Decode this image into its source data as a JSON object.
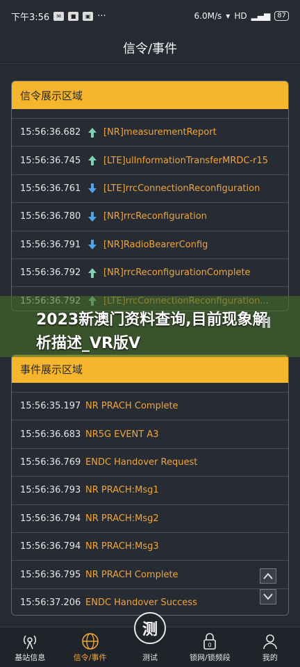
{
  "status_bar": {
    "time": "下午3:56",
    "speed": "6.0M/s",
    "battery": "87"
  },
  "title": "信令/事件",
  "signaling_panel": {
    "header": "信令展示区域",
    "rows": [
      {
        "time": "15:56:36.682",
        "dir": "up",
        "msg": "[NR]measurementReport"
      },
      {
        "time": "15:56:36.745",
        "dir": "up",
        "msg": "[LTE]ulInformationTransferMRDC-r15"
      },
      {
        "time": "15:56:36.761",
        "dir": "down",
        "msg": "[LTE]rrcConnectionReconfiguration"
      },
      {
        "time": "15:56:36.780",
        "dir": "down",
        "msg": "[NR]rrcReconfiguration"
      },
      {
        "time": "15:56:36.791",
        "dir": "down",
        "msg": "[NR]RadioBearerConfig"
      },
      {
        "time": "15:56:36.792",
        "dir": "up",
        "msg": "[NR]rrcReconfigurationComplete"
      },
      {
        "time": "15:56:36.792",
        "dir": "up",
        "msg": "[LTE]rrcConnectionReconfiguration..."
      }
    ]
  },
  "event_panel": {
    "header": "事件展示区域",
    "rows": [
      {
        "time": "15:56:35.197",
        "msg": "NR PRACH Complete"
      },
      {
        "time": "15:56:36.683",
        "msg": "NR5G EVENT A3"
      },
      {
        "time": "15:56:36.769",
        "msg": "ENDC Handover Request"
      },
      {
        "time": "15:56:36.793",
        "msg": "NR PRACH:Msg1"
      },
      {
        "time": "15:56:36.794",
        "msg": "NR PRACH:Msg2"
      },
      {
        "time": "15:56:36.794",
        "msg": "NR PRACH:Msg3"
      },
      {
        "time": "15:56:36.795",
        "msg": "NR PRACH Complete"
      },
      {
        "time": "15:56:37.206",
        "msg": "ENDC Handover Success"
      }
    ]
  },
  "watermark": "2023新澳门资料查询,目前现象解析描述_VR版V",
  "nav": [
    {
      "label": "基站信息",
      "icon": "antenna-icon"
    },
    {
      "label": "信令/事件",
      "icon": "globe-icon"
    },
    {
      "label": "测试",
      "icon": "test-icon",
      "glyph": "测"
    },
    {
      "label": "锁网/锁频段",
      "icon": "lock-icon"
    },
    {
      "label": "我的",
      "icon": "user-icon"
    }
  ],
  "colors": {
    "accent": "#f5b62d",
    "message": "#f0a43a",
    "arrow_up": "#7fd3b0",
    "arrow_down": "#4fa3e6"
  }
}
